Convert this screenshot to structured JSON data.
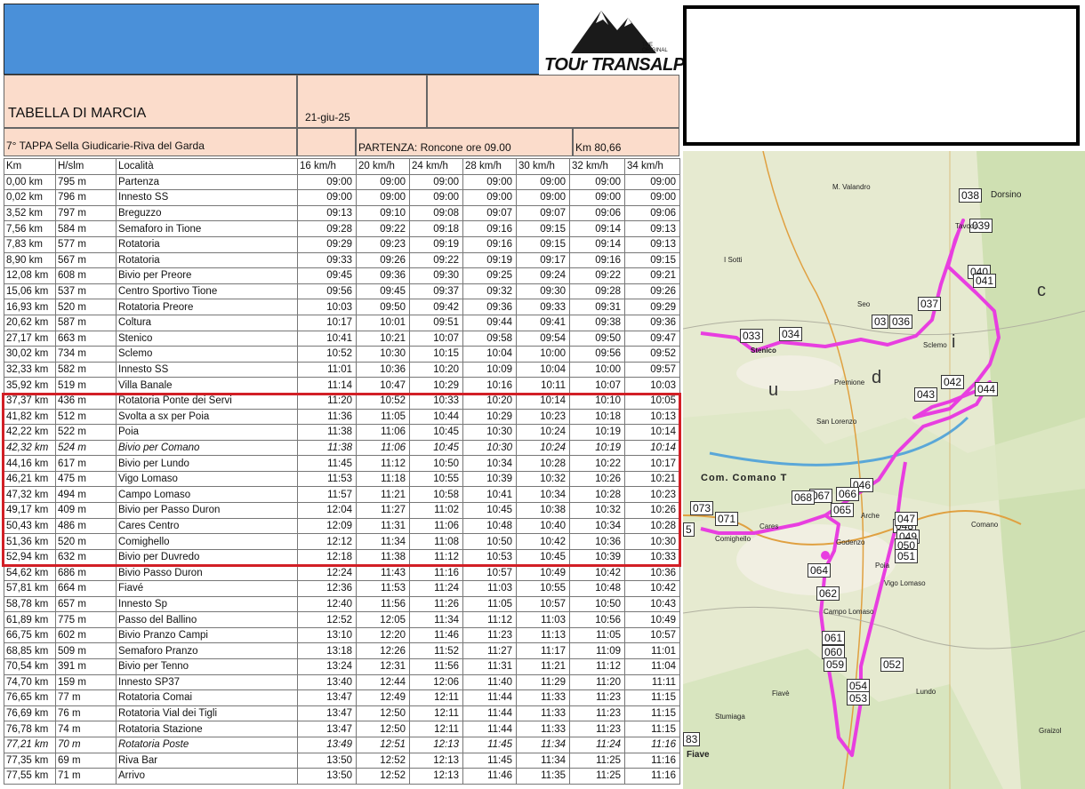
{
  "header": {
    "title": "TABELLA DI MARCIA",
    "date": "21-giu-25",
    "stage": "7° TAPPA Sella Giudicarie-Riva del Garda",
    "start": "PARTENZA: Roncone ore 09.00",
    "distance": "Km 80,66"
  },
  "logo": {
    "text": "TOUr TRANSALP",
    "sub": "THE ORIGINAL"
  },
  "table": {
    "columns": [
      "Km",
      "H/slm",
      "Località",
      "16 km/h",
      "20 km/h",
      "24 km/h",
      "28 km/h",
      "30 km/h",
      "32 km/h",
      "34 km/h"
    ],
    "rows": [
      [
        "0,00 km",
        "795 m",
        "Partenza",
        "09:00",
        "09:00",
        "09:00",
        "09:00",
        "09:00",
        "09:00",
        "09:00"
      ],
      [
        "0,02 km",
        "796 m",
        "Innesto SS",
        "09:00",
        "09:00",
        "09:00",
        "09:00",
        "09:00",
        "09:00",
        "09:00"
      ],
      [
        "3,52 km",
        "797 m",
        "Breguzzo",
        "09:13",
        "09:10",
        "09:08",
        "09:07",
        "09:07",
        "09:06",
        "09:06"
      ],
      [
        "7,56 km",
        "584 m",
        "Semaforo in Tione",
        "09:28",
        "09:22",
        "09:18",
        "09:16",
        "09:15",
        "09:14",
        "09:13"
      ],
      [
        "7,83 km",
        "577 m",
        "Rotatoria",
        "09:29",
        "09:23",
        "09:19",
        "09:16",
        "09:15",
        "09:14",
        "09:13"
      ],
      [
        "8,90 km",
        "567 m",
        "Rotatoria",
        "09:33",
        "09:26",
        "09:22",
        "09:19",
        "09:17",
        "09:16",
        "09:15"
      ],
      [
        "12,08 km",
        "608 m",
        "Bivio per Preore",
        "09:45",
        "09:36",
        "09:30",
        "09:25",
        "09:24",
        "09:22",
        "09:21"
      ],
      [
        "15,06 km",
        "537 m",
        "Centro Sportivo Tione",
        "09:56",
        "09:45",
        "09:37",
        "09:32",
        "09:30",
        "09:28",
        "09:26"
      ],
      [
        "16,93 km",
        "520 m",
        "Rotatoria Preore",
        "10:03",
        "09:50",
        "09:42",
        "09:36",
        "09:33",
        "09:31",
        "09:29"
      ],
      [
        "20,62 km",
        "587 m",
        "Coltura",
        "10:17",
        "10:01",
        "09:51",
        "09:44",
        "09:41",
        "09:38",
        "09:36"
      ],
      [
        "27,17 km",
        "663 m",
        "Stenico",
        "10:41",
        "10:21",
        "10:07",
        "09:58",
        "09:54",
        "09:50",
        "09:47"
      ],
      [
        "30,02 km",
        "734 m",
        "Sclemo",
        "10:52",
        "10:30",
        "10:15",
        "10:04",
        "10:00",
        "09:56",
        "09:52"
      ],
      [
        "32,33 km",
        "582 m",
        "Innesto SS",
        "11:01",
        "10:36",
        "10:20",
        "10:09",
        "10:04",
        "10:00",
        "09:57"
      ],
      [
        "35,92 km",
        "519 m",
        "Villa Banale",
        "11:14",
        "10:47",
        "10:29",
        "10:16",
        "10:11",
        "10:07",
        "10:03"
      ],
      [
        "37,37 km",
        "436 m",
        "Rotatoria Ponte dei Servi",
        "11:20",
        "10:52",
        "10:33",
        "10:20",
        "10:14",
        "10:10",
        "10:05"
      ],
      [
        "41,82 km",
        "512 m",
        "Svolta a sx per Poia",
        "11:36",
        "11:05",
        "10:44",
        "10:29",
        "10:23",
        "10:18",
        "10:13"
      ],
      [
        "42,22 km",
        "522 m",
        "Poia",
        "11:38",
        "11:06",
        "10:45",
        "10:30",
        "10:24",
        "10:19",
        "10:14"
      ],
      [
        "42,32 km",
        "524 m",
        "Bivio per Comano",
        "11:38",
        "11:06",
        "10:45",
        "10:30",
        "10:24",
        "10:19",
        "10:14"
      ],
      [
        "44,16 km",
        "617 m",
        "Bivio per Lundo",
        "11:45",
        "11:12",
        "10:50",
        "10:34",
        "10:28",
        "10:22",
        "10:17"
      ],
      [
        "46,21 km",
        "475 m",
        "Vigo Lomaso",
        "11:53",
        "11:18",
        "10:55",
        "10:39",
        "10:32",
        "10:26",
        "10:21"
      ],
      [
        "47,32 km",
        "494 m",
        "Campo Lomaso",
        "11:57",
        "11:21",
        "10:58",
        "10:41",
        "10:34",
        "10:28",
        "10:23"
      ],
      [
        "49,17 km",
        "409 m",
        "Bivio per Passo Duron",
        "12:04",
        "11:27",
        "11:02",
        "10:45",
        "10:38",
        "10:32",
        "10:26"
      ],
      [
        "50,43 km",
        "486 m",
        "Cares Centro",
        "12:09",
        "11:31",
        "11:06",
        "10:48",
        "10:40",
        "10:34",
        "10:28"
      ],
      [
        "51,36 km",
        "520 m",
        "Comighello",
        "12:12",
        "11:34",
        "11:08",
        "10:50",
        "10:42",
        "10:36",
        "10:30"
      ],
      [
        "52,94 km",
        "632 m",
        "Bivio per Duvredo",
        "12:18",
        "11:38",
        "11:12",
        "10:53",
        "10:45",
        "10:39",
        "10:33"
      ],
      [
        "54,62 km",
        "686 m",
        "Bivio Passo Duron",
        "12:24",
        "11:43",
        "11:16",
        "10:57",
        "10:49",
        "10:42",
        "10:36"
      ],
      [
        "57,81 km",
        "664 m",
        "Fiavé",
        "12:36",
        "11:53",
        "11:24",
        "11:03",
        "10:55",
        "10:48",
        "10:42"
      ],
      [
        "58,78 km",
        "657 m",
        "Innesto Sp",
        "12:40",
        "11:56",
        "11:26",
        "11:05",
        "10:57",
        "10:50",
        "10:43"
      ],
      [
        "61,89 km",
        "775 m",
        "Passo del Ballino",
        "12:52",
        "12:05",
        "11:34",
        "11:12",
        "11:03",
        "10:56",
        "10:49"
      ],
      [
        "66,75 km",
        "602 m",
        "Bivio Pranzo Campi",
        "13:10",
        "12:20",
        "11:46",
        "11:23",
        "11:13",
        "11:05",
        "10:57"
      ],
      [
        "68,85 km",
        "509 m",
        "Semaforo Pranzo",
        "13:18",
        "12:26",
        "11:52",
        "11:27",
        "11:17",
        "11:09",
        "11:01"
      ],
      [
        "70,54 km",
        "391 m",
        "Bivio per Tenno",
        "13:24",
        "12:31",
        "11:56",
        "11:31",
        "11:21",
        "11:12",
        "11:04"
      ],
      [
        "74,70 km",
        "159 m",
        "Innesto SP37",
        "13:40",
        "12:44",
        "12:06",
        "11:40",
        "11:29",
        "11:20",
        "11:11"
      ],
      [
        "76,65 km",
        "77 m",
        "Rotatoria Comai",
        "13:47",
        "12:49",
        "12:11",
        "11:44",
        "11:33",
        "11:23",
        "11:15"
      ],
      [
        "76,69 km",
        "76 m",
        "Rotatoria Vial dei Tigli",
        "13:47",
        "12:50",
        "12:11",
        "11:44",
        "11:33",
        "11:23",
        "11:15"
      ],
      [
        "76,78 km",
        "74 m",
        "Rotatoria Stazione",
        "13:47",
        "12:50",
        "12:11",
        "11:44",
        "11:33",
        "11:23",
        "11:15"
      ],
      [
        "77,21 km",
        "70 m",
        "Rotatoria Poste",
        "13:49",
        "12:51",
        "12:13",
        "11:45",
        "11:34",
        "11:24",
        "11:16"
      ],
      [
        "77,35 km",
        "69 m",
        "Riva Bar",
        "13:50",
        "12:52",
        "12:13",
        "11:45",
        "11:34",
        "11:25",
        "11:16"
      ],
      [
        "77,55 km",
        "71 m",
        "Arrivo",
        "13:50",
        "12:52",
        "12:13",
        "11:46",
        "11:35",
        "11:25",
        "11:16"
      ]
    ]
  },
  "map": {
    "markers": [
      "038",
      "039",
      "040",
      "041",
      "037",
      "036",
      "03",
      "033",
      "034",
      "042",
      "043",
      "044",
      "046",
      "048",
      "049",
      "050",
      "051",
      "047",
      "066",
      "067",
      "068",
      "065",
      "073",
      "071",
      "5",
      "064",
      "062",
      "061",
      "060",
      "059",
      "052",
      "054",
      "053",
      "83"
    ],
    "labels": [
      "Dorsino",
      "Tavodo",
      "M. Valandro",
      "I Sotti",
      "Seo",
      "Stenico",
      "Premione",
      "Com. Comano T",
      "Comano",
      "Cares",
      "Comighello",
      "Godenzo",
      "Poia",
      "Lundo",
      "Campo Lomaso",
      "Fiavè",
      "Stumiaga",
      "Fiave",
      "Graizol",
      "San Lorenzo",
      "Sclemo",
      "Arche",
      "Vigo Lomaso",
      "u",
      "d",
      "i",
      "c"
    ],
    "route_color": "#e83ee0"
  }
}
